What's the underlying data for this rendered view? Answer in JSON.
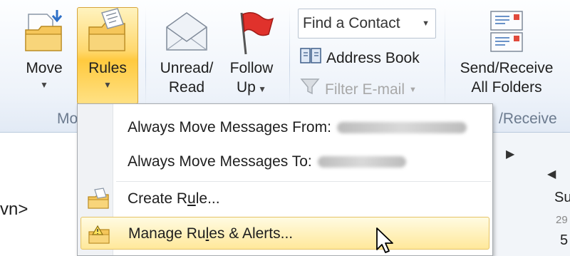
{
  "ribbon": {
    "move": {
      "label": "Move",
      "icon": "folder-move-icon"
    },
    "rules": {
      "label": "Rules",
      "icon": "rules-folder-icon"
    },
    "unread_read": {
      "line1": "Unread/",
      "line2": "Read",
      "icon": "envelope-icon"
    },
    "follow_up": {
      "line1": "Follow",
      "line2": "Up",
      "icon": "red-flag-icon"
    },
    "find_contact": {
      "placeholder": "Find a Contact"
    },
    "address_book": {
      "label": "Address Book",
      "icon": "address-book-icon"
    },
    "filter_email": {
      "label": "Filter E-mail",
      "icon": "funnel-icon"
    },
    "send_receive": {
      "line1": "Send/Receive",
      "line2": "All Folders",
      "icon": "send-receive-icon"
    },
    "group_move_label_partial": "Mo",
    "group_send_receive_label_partial": "/Receive"
  },
  "menu": {
    "items": [
      {
        "label": "Always Move Messages From:"
      },
      {
        "label": "Always Move Messages To:"
      },
      {
        "label_pre": "Create R",
        "label_accel": "u",
        "label_post": "le...",
        "icon": "create-rule-icon"
      },
      {
        "label_pre": "Manage Ru",
        "label_accel": "l",
        "label_post": "es & Alerts...",
        "icon": "manage-rules-icon"
      }
    ]
  },
  "background": {
    "left_text": "vn>",
    "calendar_day": "Su",
    "calendar_num1": "29",
    "calendar_num2": "5"
  },
  "colors": {
    "highlight": "#ffd86e",
    "ribbon_bg": "#eef3fa",
    "menu_gutter": "#f0f2f5"
  }
}
